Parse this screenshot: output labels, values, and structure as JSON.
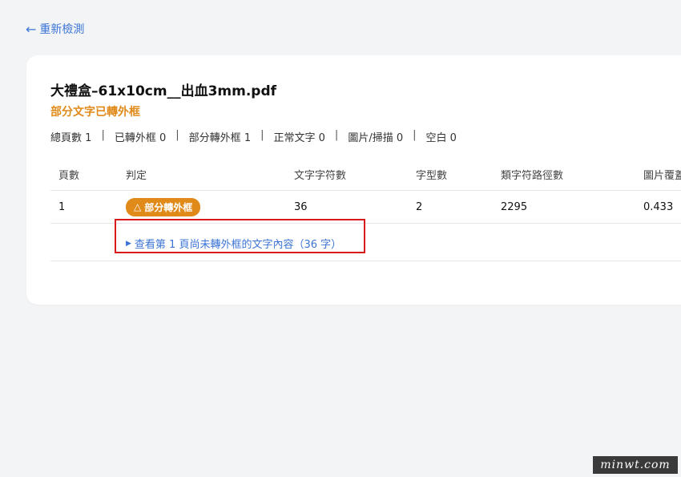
{
  "back_link": {
    "arrow": "←",
    "label": "重新檢測"
  },
  "file": {
    "title": "大禮盒–61x10cm__出血3mm.pdf",
    "status": "部分文字已轉外框"
  },
  "stats": [
    {
      "label": "總頁數",
      "value": "1"
    },
    {
      "label": "已轉外框",
      "value": "0"
    },
    {
      "label": "部分轉外框",
      "value": "1"
    },
    {
      "label": "正常文字",
      "value": "0"
    },
    {
      "label": "圖片/掃描",
      "value": "0"
    },
    {
      "label": "空白",
      "value": "0"
    }
  ],
  "stats_sep": "|",
  "table": {
    "headers": [
      "頁數",
      "判定",
      "文字字符數",
      "字型數",
      "類字符路徑數",
      "圖片覆蓋"
    ],
    "rows": [
      {
        "page": "1",
        "verdict": "部分轉外框",
        "chars": "36",
        "fonts": "2",
        "paths": "2295",
        "coverage": "0.433"
      }
    ]
  },
  "badge_icon": "△",
  "detail": {
    "tri": "▶",
    "label": "查看第 1 頁尚未轉外框的文字內容（36 字）"
  },
  "watermark": "minwt.com",
  "colors": {
    "accent": "#3b74d6",
    "warning": "#e08a1a",
    "highlight": "#d91a1a"
  }
}
